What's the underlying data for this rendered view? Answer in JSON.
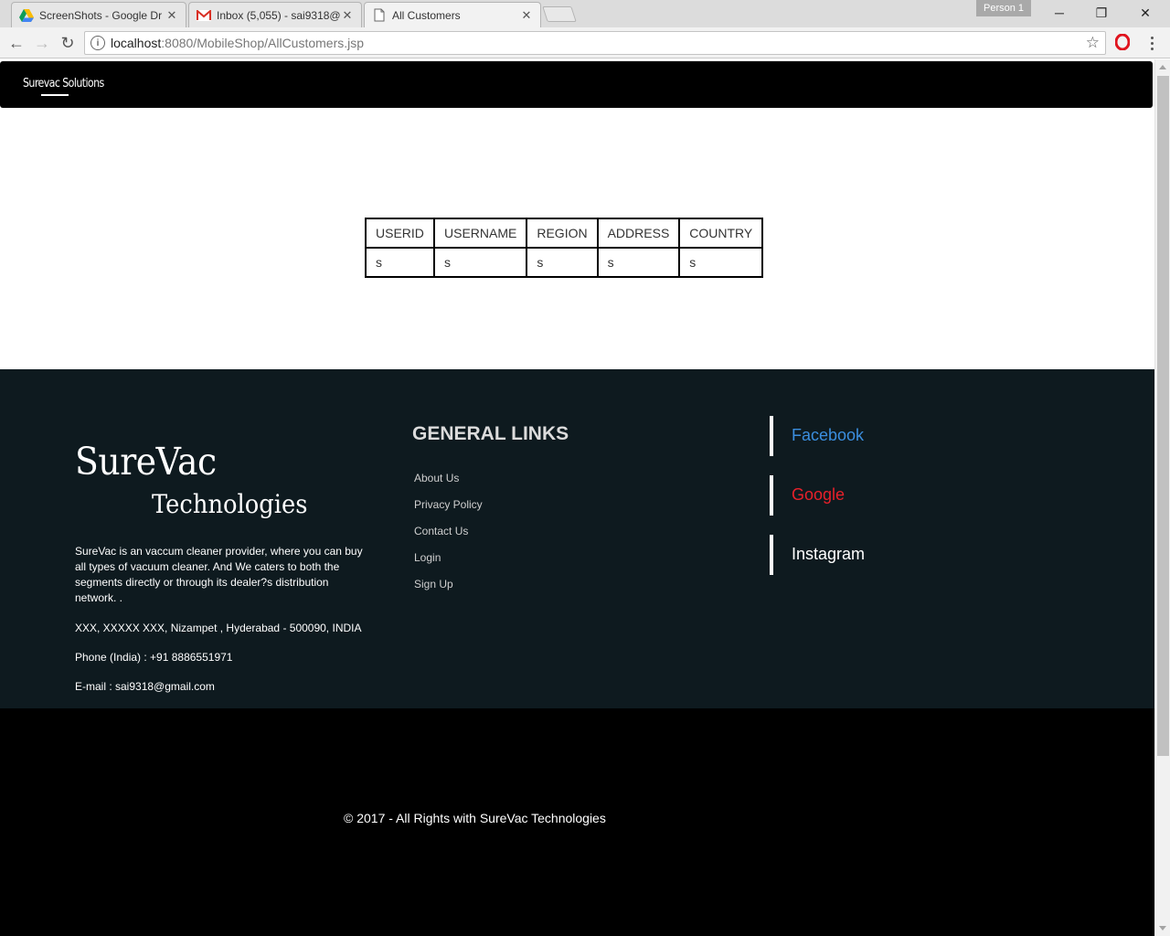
{
  "browser": {
    "tabs": [
      {
        "title": "ScreenShots - Google Dr"
      },
      {
        "title": "Inbox (5,055) - sai9318@"
      },
      {
        "title": "All Customers"
      }
    ],
    "profile_label": "Person 1",
    "address": {
      "host": "localhost",
      "path": ":8080/MobileShop/AllCustomers.jsp"
    }
  },
  "navbar": {
    "brand": "Surevac Solutions"
  },
  "customers_table": {
    "headers": [
      "USERID",
      "USERNAME",
      "REGION",
      "ADDRESS",
      "COUNTRY"
    ],
    "rows": [
      [
        "s",
        "s",
        "s",
        "s",
        "s"
      ]
    ]
  },
  "footer": {
    "logo_line1": "SureVac",
    "logo_line2": "Technologies",
    "description": "SureVac is an vaccum cleaner provider, where you can buy all types of vacuum cleaner. And We caters to both the segments directly or through its dealer?s distribution network. .",
    "address": "XXX, XXXXX XXX, Nizampet , Hyderabad - 500090, INDIA",
    "phone": "Phone (India) : +91 8886551971",
    "email": "E-mail : sai9318@gmail.com",
    "links_heading": "GENERAL LINKS",
    "links": [
      "About Us",
      "Privacy Policy",
      "Contact Us",
      "Login",
      "Sign Up"
    ],
    "social": [
      {
        "label": "Facebook",
        "color": "#3b8ede"
      },
      {
        "label": "Google",
        "color": "#e8202a"
      },
      {
        "label": "Instagram",
        "color": "#ffffff"
      }
    ]
  },
  "copyright": "© 2017 - All Rights with SureVac Technologies"
}
